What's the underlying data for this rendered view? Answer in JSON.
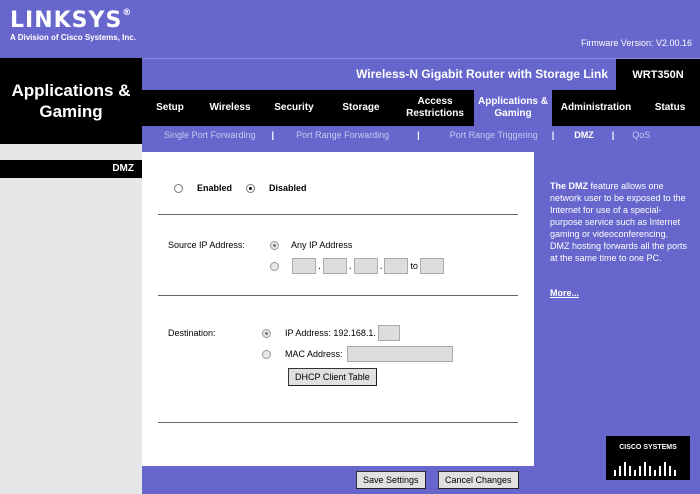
{
  "brand": {
    "logo": "LINKSYS",
    "registered": "®",
    "subtitle": "A Division of Cisco Systems, Inc."
  },
  "firmware": "Firmware Version: V2.00.16",
  "section_title": "Applications & Gaming",
  "product": {
    "name": "Wireless-N Gigabit Router with Storage Link",
    "model": "WRT350N"
  },
  "tabs": [
    {
      "label": "Setup"
    },
    {
      "label": "Wireless"
    },
    {
      "label": "Security"
    },
    {
      "label": "Storage"
    },
    {
      "label": "Access Restrictions"
    },
    {
      "label": "Applications & Gaming"
    },
    {
      "label": "Administration"
    },
    {
      "label": "Status"
    }
  ],
  "subtabs": [
    {
      "label": "Single Port Forwarding"
    },
    {
      "label": "Port Range Forwarding"
    },
    {
      "label": "Port Range Triggering"
    },
    {
      "label": "DMZ"
    },
    {
      "label": "QoS"
    }
  ],
  "left_label": "DMZ",
  "dmz": {
    "enabled_label": "Enabled",
    "disabled_label": "Disabled",
    "state": "Disabled",
    "source_label": "Source IP Address:",
    "any_ip_label": "Any IP Address",
    "source_mode": "Any IP Address",
    "range_to": "to",
    "destination_label": "Destination:",
    "ip_address_label": "IP Address: 192.168.1.",
    "mac_address_label": "MAC Address:",
    "destination_mode": "IP Address",
    "dhcp_button": "DHCP Client Table"
  },
  "help": {
    "bold": "The DMZ",
    "text": " feature allows one network user to be exposed to the Internet for use of a special-purpose service such as Internet gaming or videoconferencing. DMZ hosting forwards all the ports at the same time to one PC.",
    "more": "More..."
  },
  "buttons": {
    "save": "Save Settings",
    "cancel": "Cancel Changes"
  },
  "cisco": "CISCO SYSTEMS",
  "colors": {
    "purple": "#6666cc",
    "black": "#000000",
    "white": "#ffffff",
    "gray": "#e7e7e7"
  }
}
